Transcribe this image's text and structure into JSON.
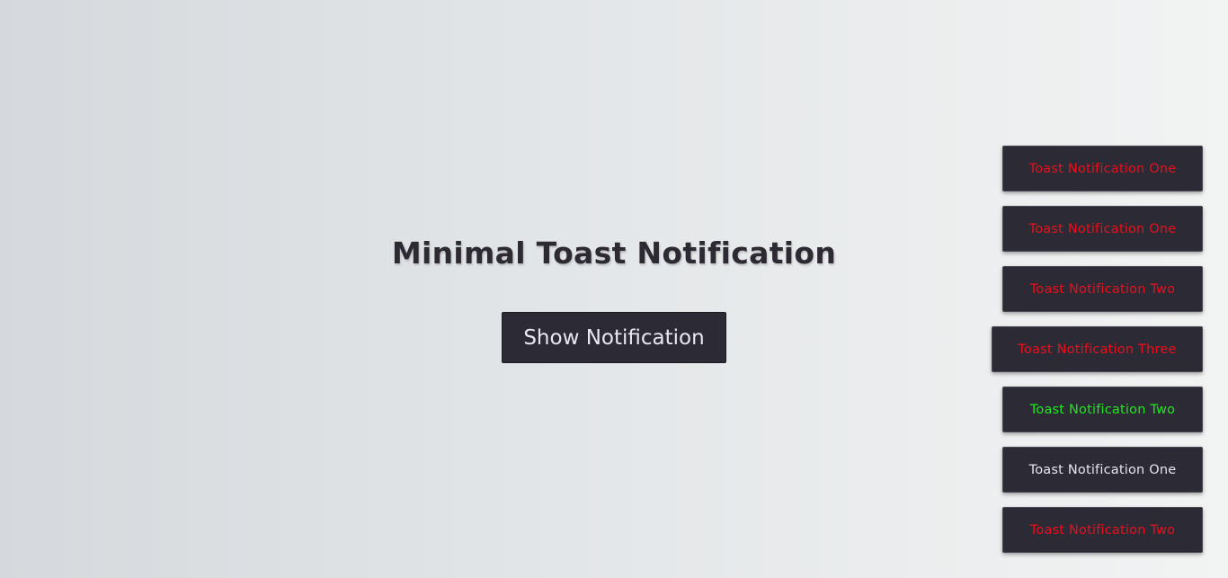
{
  "page": {
    "title": "Minimal Toast Notification",
    "show_button_label": "Show Notification"
  },
  "colors": {
    "error": "#e8101c",
    "success": "#1ee81e",
    "neutral": "#e6e4ec"
  },
  "toasts": [
    {
      "text": "Toast Notification One",
      "color": "#e8101c"
    },
    {
      "text": "Toast Notification One",
      "color": "#e8101c"
    },
    {
      "text": "Toast Notification Two",
      "color": "#e8101c"
    },
    {
      "text": "Toast Notification Three",
      "color": "#e8101c"
    },
    {
      "text": "Toast Notification Two",
      "color": "#1ee81e"
    },
    {
      "text": "Toast Notification One",
      "color": "#e6e4ec"
    },
    {
      "text": "Toast Notification Two",
      "color": "#e8101c"
    }
  ]
}
